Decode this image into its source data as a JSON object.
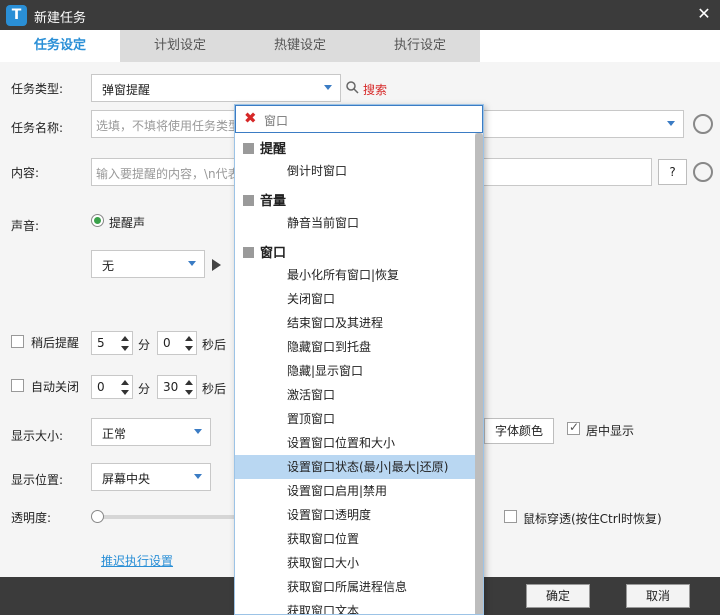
{
  "window": {
    "title": "新建任务",
    "logo_letter": "T",
    "close": "✕"
  },
  "tabs": [
    {
      "label": "任务设定",
      "active": true
    },
    {
      "label": "计划设定",
      "active": false
    },
    {
      "label": "热键设定",
      "active": false
    },
    {
      "label": "执行设定",
      "active": false
    }
  ],
  "form": {
    "task_type": {
      "label": "任务类型:",
      "value": "弹窗提醒",
      "search_label": "搜索"
    },
    "task_name": {
      "label": "任务名称:",
      "placeholder": "选填，不填将使用任务类型"
    },
    "content": {
      "label": "内容:",
      "placeholder": "输入要提醒的内容，\\n代表",
      "help": "?"
    },
    "sound": {
      "label": "声音:",
      "option": "提醒声",
      "select": "无"
    },
    "remind_later": {
      "label": "稍后提醒",
      "min": "5",
      "min_unit": "分",
      "sec": "0",
      "sec_unit": "秒后"
    },
    "auto_close": {
      "label": "自动关闭",
      "min": "0",
      "min_unit": "分",
      "sec": "30",
      "sec_unit": "秒后"
    },
    "display_size": {
      "label": "显示大小:",
      "value": "正常"
    },
    "font_color": {
      "label": "字体颜色"
    },
    "center": {
      "label": "居中显示",
      "checked": true
    },
    "display_pos": {
      "label": "显示位置:",
      "value": "屏幕中央"
    },
    "opacity": {
      "label": "透明度:"
    },
    "mouse_through": {
      "label": "鼠标穿透(按住Ctrl时恢复)"
    },
    "delay_link": "推迟执行设置"
  },
  "footer": {
    "ok": "确定",
    "cancel": "取消"
  },
  "dropdown": {
    "search_value": "窗口",
    "groups": [
      {
        "label": "提醒",
        "items": [
          "倒计时窗口"
        ]
      },
      {
        "label": "音量",
        "items": [
          "静音当前窗口"
        ]
      },
      {
        "label": "窗口",
        "items": [
          "最小化所有窗口|恢复",
          "关闭窗口",
          "结束窗口及其进程",
          "隐藏窗口到托盘",
          "隐藏|显示窗口",
          "激活窗口",
          "置顶窗口",
          "设置窗口位置和大小",
          "设置窗口状态(最小|最大|还原)",
          "设置窗口启用|禁用",
          "设置窗口透明度",
          "获取窗口位置",
          "获取窗口大小",
          "获取窗口所属进程信息",
          "获取窗口文本"
        ]
      }
    ],
    "selected_item": "设置窗口状态(最小|最大|还原)"
  },
  "colors": {
    "accent": "#2a8fd6",
    "titlebar": "#3b3b3b",
    "search_link": "#d62828",
    "selected": "#b9d7f2"
  }
}
